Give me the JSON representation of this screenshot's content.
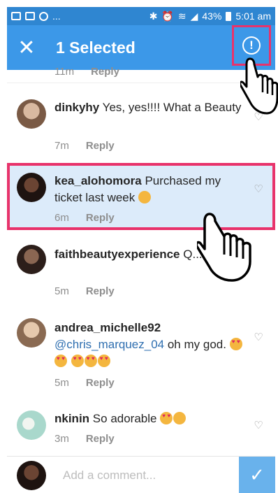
{
  "statusbar": {
    "battery_percent": "43%",
    "time": "5:01 am",
    "dots": "..."
  },
  "appbar": {
    "close_icon": "close-icon",
    "title": "1 Selected",
    "report_icon": "report-exclamation-icon"
  },
  "comments": [
    {
      "username": "",
      "text": "",
      "time": "11m",
      "reply": "Reply"
    },
    {
      "username": "dinkyhy",
      "text": "Yes, yes!!!! What a Beauty",
      "time": "7m",
      "reply": "Reply",
      "avatar_color": "#b98c6f"
    },
    {
      "username": "kea_alohomora",
      "text": "Purchased my ticket last week",
      "time": "6m",
      "reply": "Reply",
      "selected": true,
      "avatar_color": "#4a2e22"
    },
    {
      "username": "faithbeautyexperience",
      "text": "Q...",
      "time": "5m",
      "reply": "Reply",
      "avatar_color": "#6b4a3a"
    },
    {
      "username": "andrea_michelle92",
      "mention": "@chris_marquez_04",
      "text": "oh my god.",
      "time": "5m",
      "reply": "Reply",
      "avatar_color": "#c9a98a"
    },
    {
      "username": "nkinin",
      "text": "So adorable",
      "time": "3m",
      "reply": "Reply",
      "avatar_color": "#9fd3c7"
    }
  ],
  "input": {
    "placeholder": "Add a comment...",
    "send_icon": "checkmark-icon"
  },
  "colors": {
    "appbar": "#3c98e8",
    "statusbar": "#2f86d1",
    "selection_outline": "#e8336b",
    "selected_row": "#dcebfa"
  }
}
